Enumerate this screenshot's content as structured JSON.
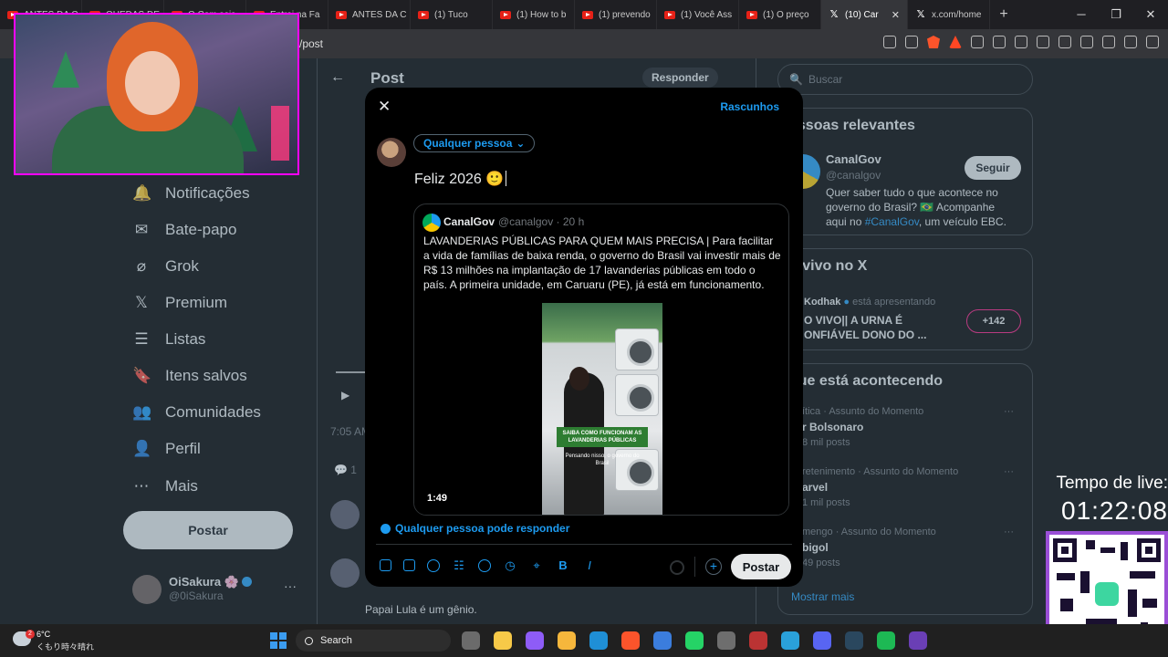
{
  "browser": {
    "tabs": [
      {
        "label": "ANTES DA C"
      },
      {
        "label": "QUEDAS DE"
      },
      {
        "label": "O Com seis"
      },
      {
        "label": "Entrei na Fa"
      },
      {
        "label": "ANTES DA C"
      },
      {
        "label": "(1) Tuco"
      },
      {
        "label": "(1) How to b"
      },
      {
        "label": "(1) prevendo"
      },
      {
        "label": "(1) Você Ass"
      },
      {
        "label": "(1) O preço"
      },
      {
        "label": "(10) Car"
      },
      {
        "label": "x.com/home"
      }
    ],
    "url_fragment": "/post"
  },
  "sidebar": {
    "items": [
      {
        "label": "Notificações",
        "icon": "bell-icon"
      },
      {
        "label": "Bate-papo",
        "icon": "mail-icon"
      },
      {
        "label": "Grok",
        "icon": "grok-icon"
      },
      {
        "label": "Premium",
        "icon": "x-logo-icon"
      },
      {
        "label": "Listas",
        "icon": "list-icon"
      },
      {
        "label": "Itens salvos",
        "icon": "bookmark-icon"
      },
      {
        "label": "Comunidades",
        "icon": "people-icon"
      },
      {
        "label": "Perfil",
        "icon": "person-icon"
      },
      {
        "label": "Mais",
        "icon": "more-circle-icon"
      }
    ],
    "post_button": "Postar",
    "account": {
      "name": "OiSakura 🌸",
      "handle": "@0iSakura"
    }
  },
  "thread": {
    "title": "Post",
    "reply_button": "Responder",
    "time": "7:05 AM",
    "comment_count": "1",
    "reply_text": "Papai Lula é um gênio."
  },
  "right": {
    "search_placeholder": "Buscar",
    "relevant": {
      "title": "essoas relevantes",
      "name": "CanalGov",
      "handle": "@canalgov",
      "follow": "Seguir",
      "bio": "Quer saber tudo o que acontece no governo do Brasil? 🇧🇷 Acompanhe aqui no",
      "bio_tag": "#CanalGov",
      "bio_end": ", um veículo EBC."
    },
    "live": {
      "title": "o vivo no X",
      "host": "Kodhak",
      "host_suffix": "está apresentando",
      "stream_title": "O VIVO|| A URNA É ONFIÁVEL DONO DO ...",
      "badge": "+142"
    },
    "trending": {
      "title": "que está acontecendo",
      "items": [
        {
          "context": "ítica · Assunto do Momento",
          "name": "r Bolsonaro",
          "count": "8 mil posts"
        },
        {
          "context": "retenimento · Assunto do Momento",
          "name": "arvel",
          "count": "1 mil posts"
        },
        {
          "context": "mengo · Assunto do Momento",
          "name": "bigol",
          "count": "49 posts"
        }
      ],
      "show_more": "Mostrar mais"
    }
  },
  "compose": {
    "drafts": "Rascunhos",
    "audience": "Qualquer pessoa",
    "text": "Feliz 2026 🙂",
    "quote": {
      "name": "CanalGov",
      "meta": "@canalgov · 20 h",
      "body": "LAVANDERIAS PÚBLICAS PARA QUEM MAIS PRECISA | Para facilitar a vida de famílias de baixa renda, o governo do Brasil vai investir mais de R$ 13 milhões na implantação de 17 lavanderias públicas em todo o país. A primeira unidade, em Caruaru (PE), já está em funcionamento.",
      "video_caption": "SAIBA COMO FUNCIONAM AS LAVANDERIAS PÚBLICAS",
      "video_sub": "Pensando nisso, o governo do Brasil",
      "duration": "1:49"
    },
    "reply_setting": "Qualquer pessoa pode responder",
    "submit": "Postar"
  },
  "stream": {
    "timer_label": "Tempo de live:",
    "timer_value": "01:22:08"
  },
  "taskbar": {
    "temp": "6°C",
    "weather": "くもり時々晴れ",
    "weather_badge": "2",
    "search": "Search",
    "app_colors": [
      "#6b6b6b",
      "#f7c948",
      "#8e5cf7",
      "#f6b73c",
      "#1f8fd6",
      "#fb542b",
      "#3b7ddd",
      "#25d366",
      "#6e6e6e",
      "#b33",
      "#2aa1da",
      "#5865f2",
      "#2a475e",
      "#1db954",
      "#6a3fb5"
    ]
  }
}
